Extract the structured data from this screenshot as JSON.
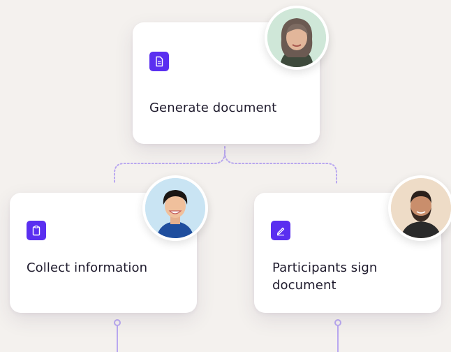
{
  "nodes": {
    "generate": {
      "label": "Generate document",
      "icon": "document-icon",
      "avatar": "avatar-woman-gray-hair"
    },
    "collect": {
      "label": "Collect information",
      "icon": "clipboard-icon",
      "avatar": "avatar-woman-short-hair"
    },
    "sign": {
      "label": "Participants sign document",
      "icon": "pen-icon",
      "avatar": "avatar-man-beard"
    }
  },
  "colors": {
    "background": "#f4f1ee",
    "icon_accent": "#5a2ff0",
    "connector": "#b9a8f0",
    "card": "#ffffff",
    "text": "#1f1b2d"
  }
}
